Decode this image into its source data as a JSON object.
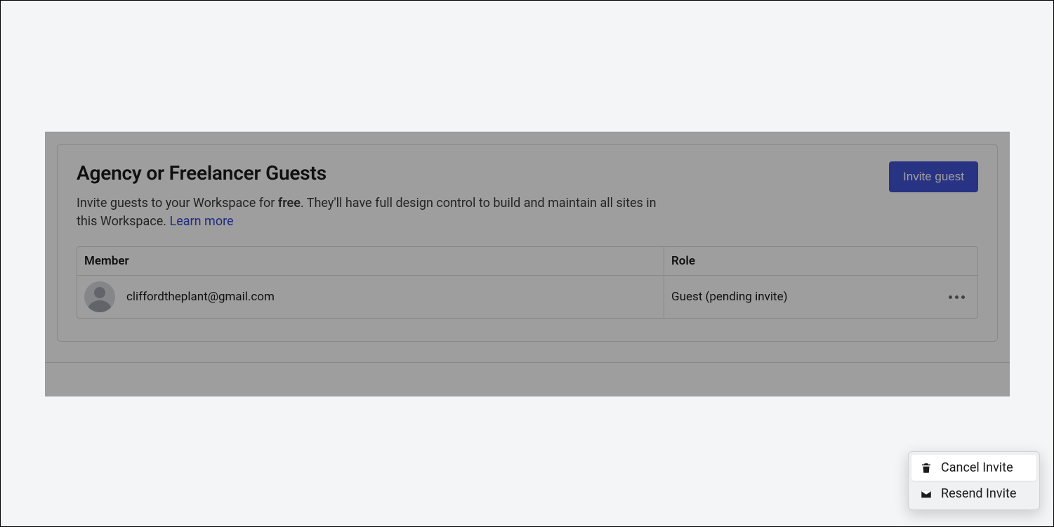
{
  "section": {
    "title": "Agency or Freelancer Guests",
    "desc_pre": "Invite guests to your Workspace for ",
    "desc_bold": "free",
    "desc_post": ". They'll have full design control to build and maintain all sites in this Workspace. ",
    "learn_more": "Learn more",
    "invite_button": "Invite guest"
  },
  "table": {
    "headers": {
      "member": "Member",
      "role": "Role"
    },
    "rows": [
      {
        "email": "cliffordtheplant@gmail.com",
        "role": "Guest (pending invite)"
      }
    ]
  },
  "menu": {
    "cancel": "Cancel Invite",
    "resend": "Resend Invite"
  }
}
